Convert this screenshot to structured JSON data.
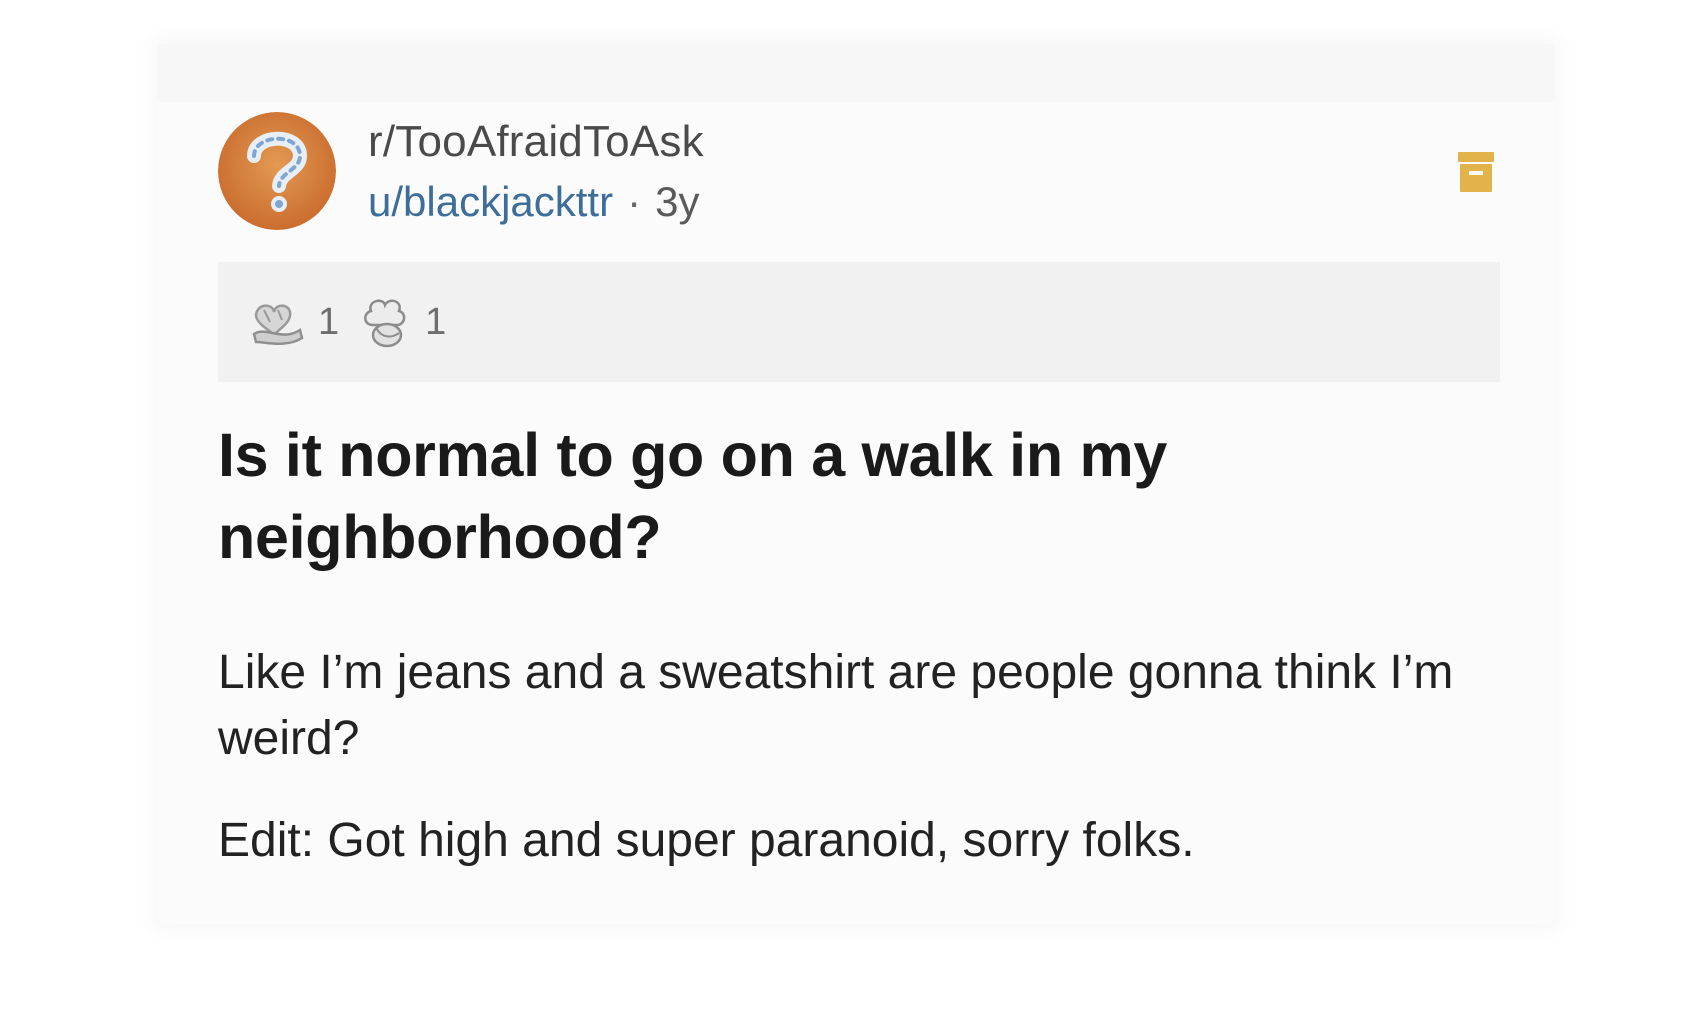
{
  "post": {
    "subreddit": "r/TooAfraidToAsk",
    "username": "u/blackjackttr",
    "separator": "·",
    "age": "3y",
    "awards": [
      {
        "icon": "heart-hands-award-icon",
        "count": "1"
      },
      {
        "icon": "thinking-brain-award-icon",
        "count": "1"
      }
    ],
    "title": "Is it normal to go on a walk in my neighborhood?",
    "body_paragraphs": [
      "Like I’m jeans and a sweatshirt are people gonna think I’m weird?",
      "Edit: Got high and super paranoid, sorry folks."
    ]
  },
  "icons": {
    "avatar": "subreddit-question-mark-avatar",
    "archive": "archive-box-icon"
  },
  "colors": {
    "username": "#3d6d9a",
    "archive_icon": "#e2b34a",
    "avatar_bg": "#d9823b"
  }
}
